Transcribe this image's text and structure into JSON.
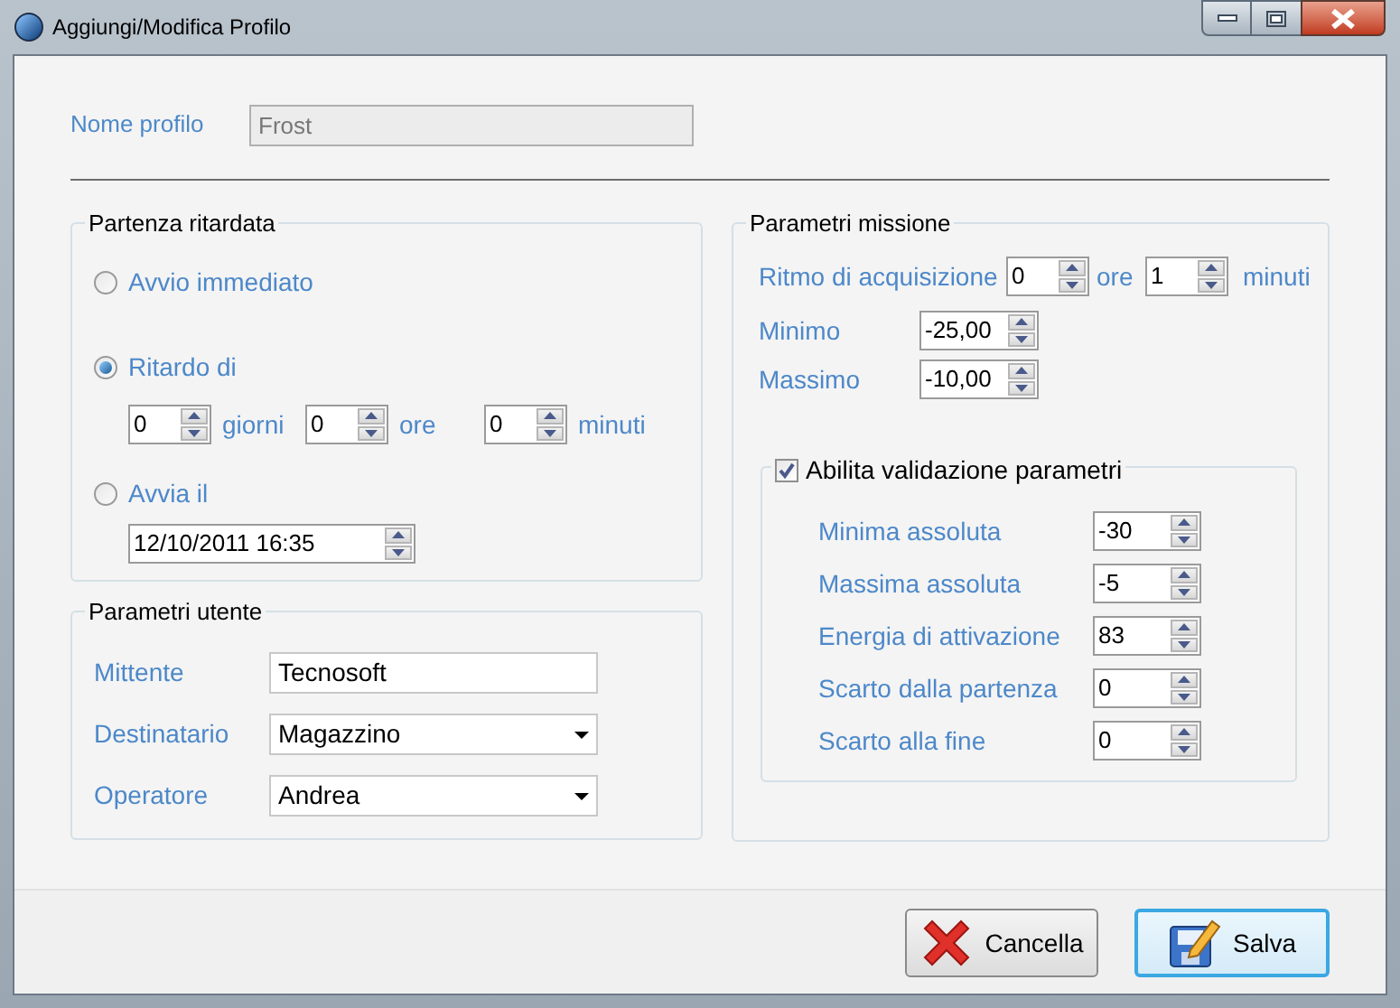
{
  "window": {
    "title": "Aggiungi/Modifica Profilo"
  },
  "profile_name": {
    "label": "Nome profilo",
    "value": "Frost",
    "disabled": true
  },
  "delayed_start": {
    "title": "Partenza ritardata",
    "options": [
      {
        "label": "Avvio immediato",
        "selected": false
      },
      {
        "label": "Ritardo di",
        "selected": true
      },
      {
        "label": "Avvia il",
        "selected": false
      }
    ],
    "delay": [
      {
        "value": "0",
        "unit": "giorni"
      },
      {
        "value": "0",
        "unit": "ore"
      },
      {
        "value": "0",
        "unit": "minuti"
      }
    ],
    "start_at": "12/10/2011 16:35"
  },
  "user_params": {
    "title": "Parametri utente",
    "fields": [
      {
        "kind": "text",
        "label": "Mittente",
        "value": "Tecnosoft"
      },
      {
        "kind": "dropdown",
        "label": "Destinatario",
        "value": "Magazzino"
      },
      {
        "kind": "dropdown",
        "label": "Operatore",
        "value": "Andrea"
      }
    ]
  },
  "mission_params": {
    "title": "Parametri missione",
    "rate": {
      "label": "Ritmo di acquisizione",
      "hours": "0",
      "hours_unit": "ore",
      "minutes": "1",
      "minutes_unit": "minuti"
    },
    "fields": [
      {
        "label": "Minimo",
        "value": "-25,00"
      },
      {
        "label": "Massimo",
        "value": "-10,00"
      }
    ],
    "validation": {
      "label": "Abilita validazione parametri",
      "checked": true,
      "fields": [
        {
          "label": "Minima assoluta",
          "value": "-30"
        },
        {
          "label": "Massima assoluta",
          "value": "-5"
        },
        {
          "label": "Energia di attivazione",
          "value": "83"
        },
        {
          "label": "Scarto dalla partenza",
          "value": "0"
        },
        {
          "label": "Scarto alla fine",
          "value": "0"
        }
      ]
    }
  },
  "buttons": [
    {
      "kind": "cancel",
      "label": "Cancella",
      "focused": false
    },
    {
      "kind": "save",
      "label": "Salva",
      "focused": true
    }
  ]
}
